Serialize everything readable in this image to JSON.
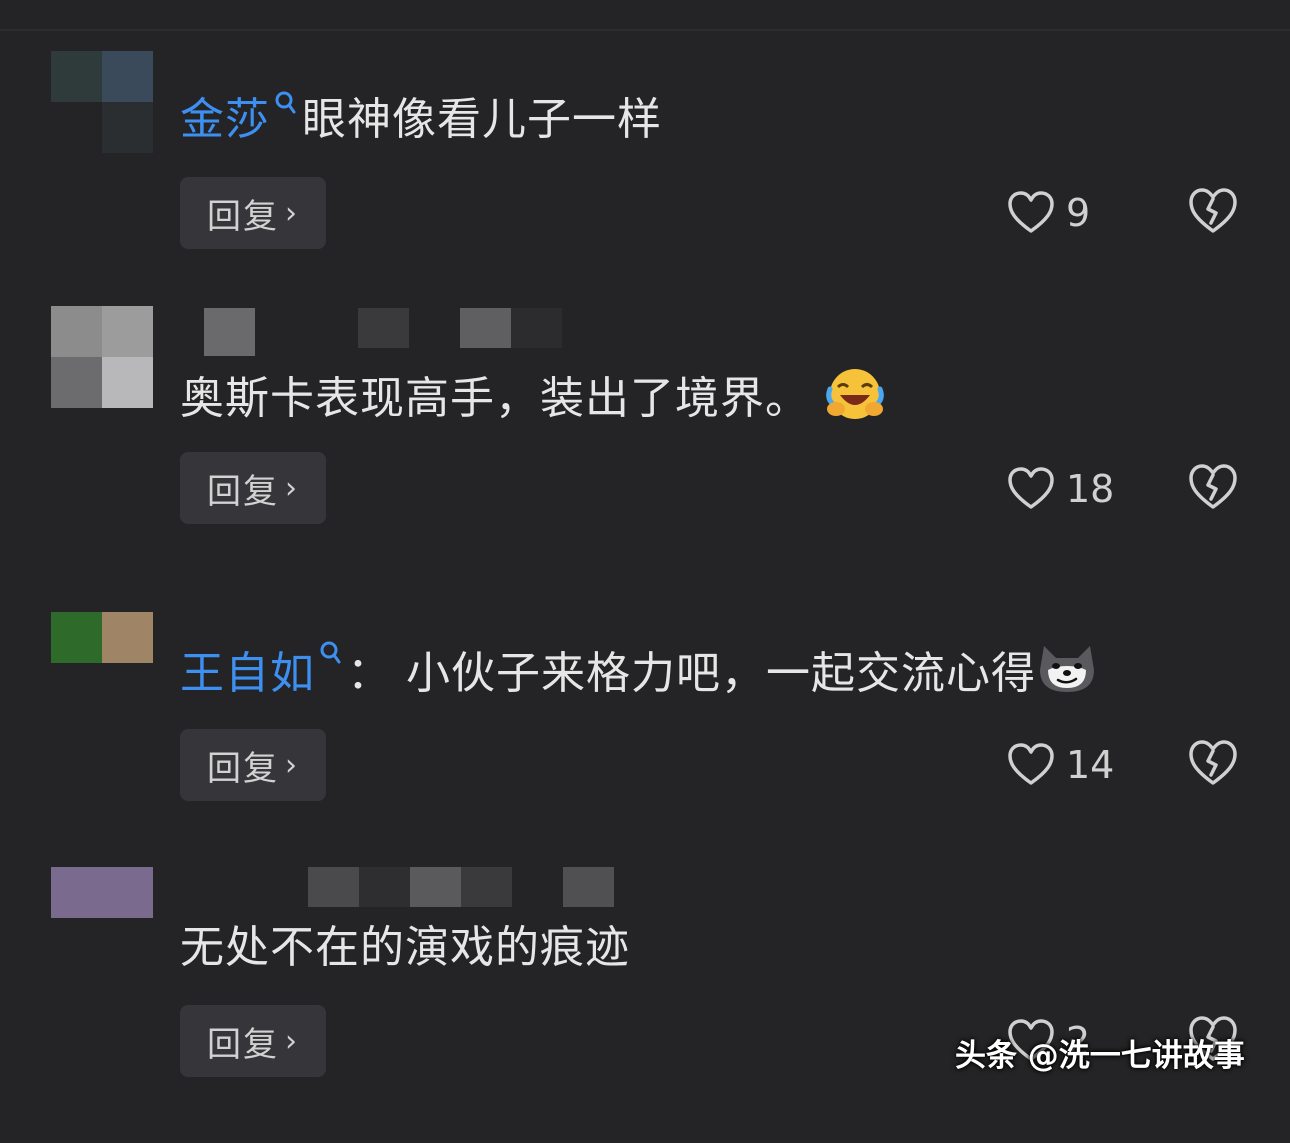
{
  "comments": [
    {
      "username": "金莎",
      "text": "眼神像看儿子一样",
      "show_colon": false,
      "reply_label": "回复",
      "likes": "9"
    },
    {
      "username": "",
      "text": "奥斯卡表现高手，装出了境界。",
      "show_colon": false,
      "reply_label": "回复",
      "likes": "18"
    },
    {
      "username": "王自如",
      "text": "小伙子来格力吧，一起交流心得",
      "colon": "：",
      "show_colon": true,
      "reply_label": "回复",
      "likes": "14"
    },
    {
      "username": "",
      "text": "无处不在的演戏的痕迹",
      "show_colon": false,
      "reply_label": "回复",
      "likes": "2"
    }
  ],
  "icons": {
    "search": "search-icon",
    "like": "heart-outline-icon",
    "dislike": "broken-heart-icon",
    "chevron": "chevron-right-icon",
    "emoji_laugh": "laughing-face-emoji",
    "emoji_dog": "smirk-dog-emoji"
  },
  "colors": {
    "background": "#242426",
    "username": "#3d8ff0",
    "button": "#36363a"
  },
  "watermark": "头条 @洗一七讲故事"
}
